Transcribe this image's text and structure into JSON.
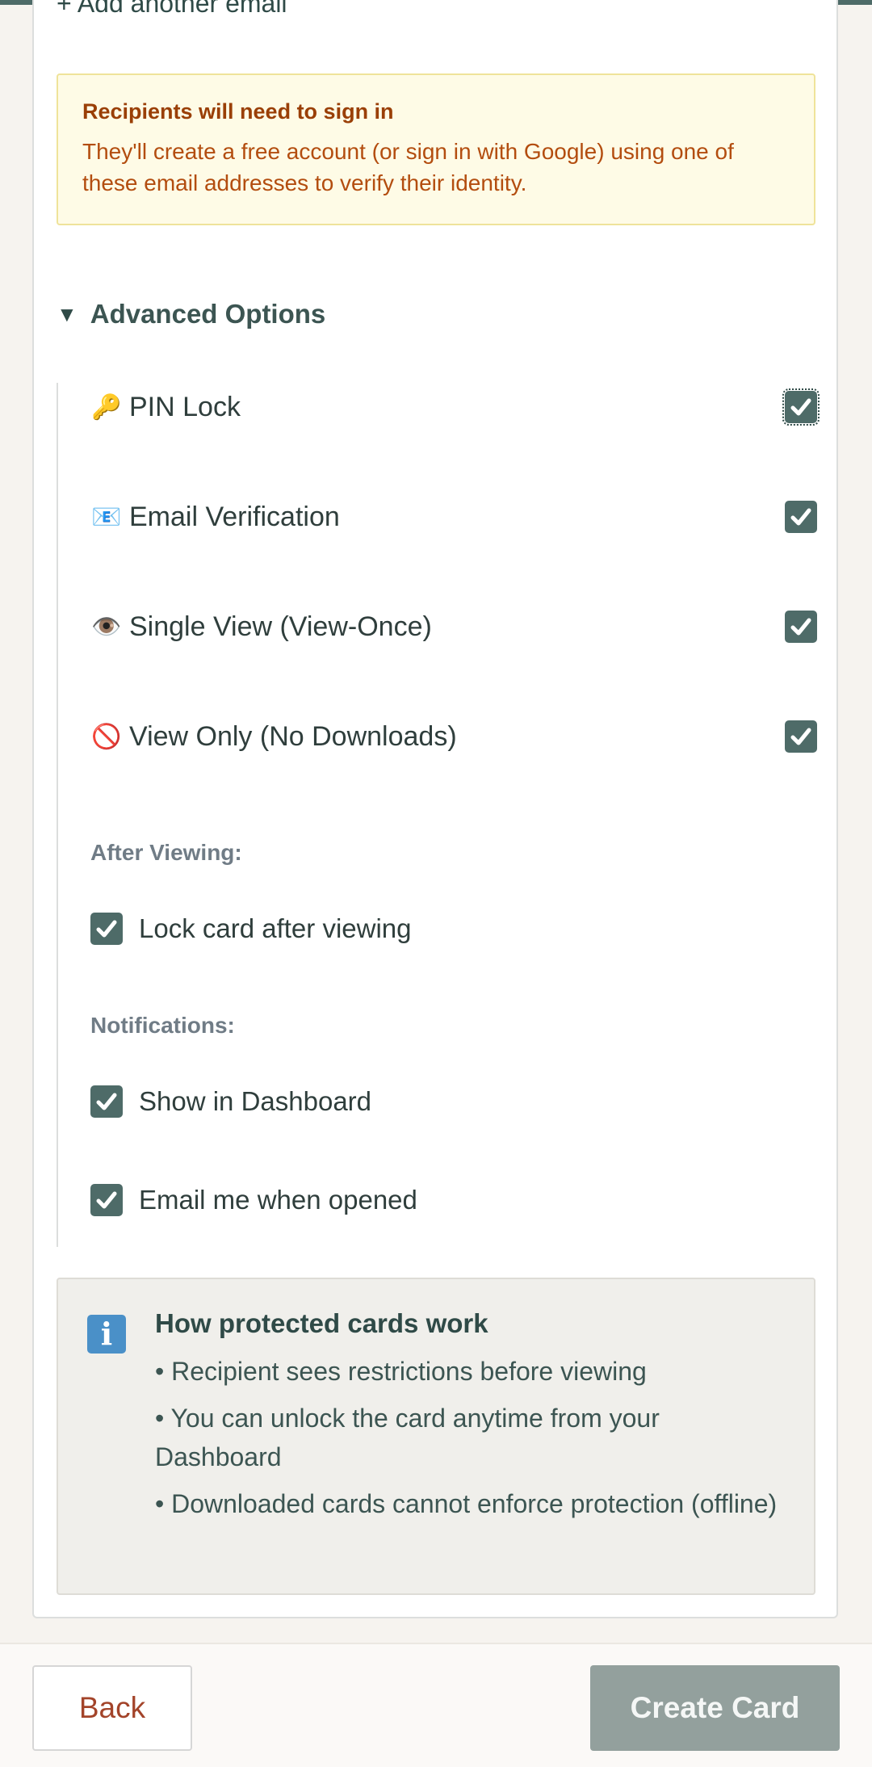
{
  "add_email_link": "+ Add another email",
  "warning": {
    "title": "Recipients will need to sign in",
    "body": "They'll create a free account (or sign in with Google) using one of these email addresses to verify their identity."
  },
  "advanced": {
    "toggle_icon": "▼",
    "title": "Advanced Options",
    "options": [
      {
        "icon": "🔑",
        "icon_name": "key-icon",
        "label": "PIN Lock",
        "checked": true
      },
      {
        "icon": "📧",
        "icon_name": "email-icon",
        "label": "Email Verification",
        "checked": true
      },
      {
        "icon": "👁️",
        "icon_name": "eye-icon",
        "label": "Single View (View-Once)",
        "checked": true
      },
      {
        "icon": "🚫",
        "icon_name": "prohibited-icon",
        "label": "View Only (No Downloads)",
        "checked": true
      }
    ],
    "after_viewing": {
      "label": "After Viewing:",
      "lock_after": {
        "label": "Lock card after viewing",
        "checked": true
      }
    },
    "notifications": {
      "label": "Notifications:",
      "show_dashboard": {
        "label": "Show in Dashboard",
        "checked": true
      },
      "email_opened": {
        "label": "Email me when opened",
        "checked": true
      }
    }
  },
  "info": {
    "icon": "i",
    "title": "How protected cards work",
    "items": [
      "• Recipient sees restrictions before viewing",
      "• You can unlock the card anytime from your Dashboard",
      "• Downloaded cards cannot enforce protection (offline)"
    ]
  },
  "footer": {
    "back_label": "Back",
    "create_label": "Create Card"
  },
  "colors": {
    "accent": "#4e6b68",
    "warning_bg": "#fefbe6",
    "warning_text": "#b34d0f",
    "back_text": "#a3442a",
    "create_disabled_bg": "#93a09d"
  }
}
